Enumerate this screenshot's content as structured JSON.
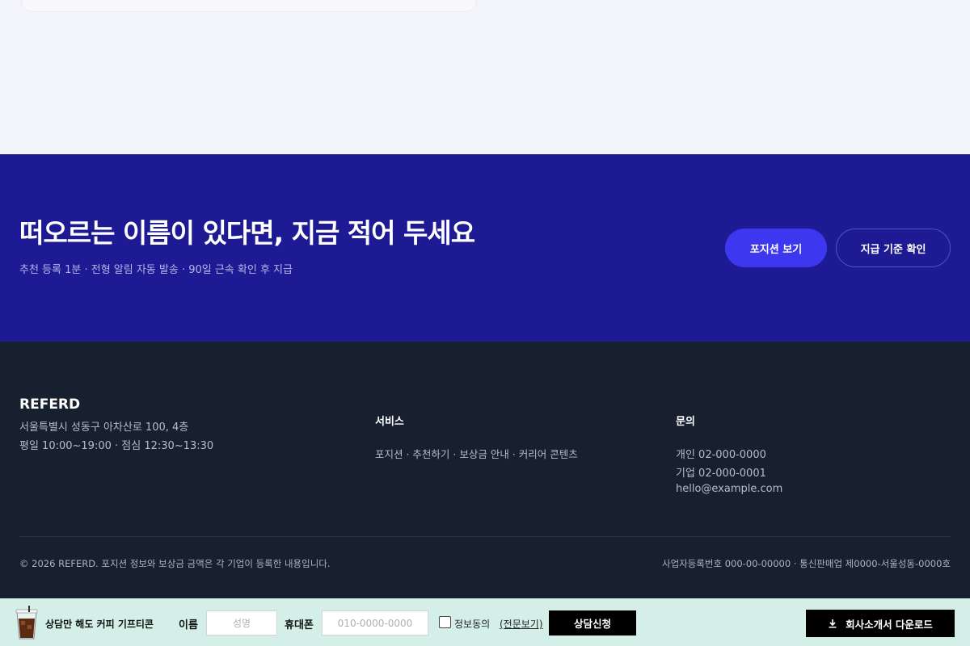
{
  "cta": {
    "title": "떠오르는 이름이 있다면, 지금 적어 두세요",
    "subtitle": "추천 등록 1분 · 전형 알림 자동 발송 · 90일 근속 확인 후 지급",
    "primary_button": "포지션 보기",
    "secondary_button": "지급 기준 확인"
  },
  "footer": {
    "brand": "REFERD",
    "address": "서울특별시 성동구 아차산로 100, 4층",
    "hours": "평일 10:00~19:00 · 점심 12:30~13:30",
    "services": {
      "heading": "서비스",
      "links": "포지션 · 추천하기 · 보상금 안내 · 커리어 콘텐츠"
    },
    "inquiry": {
      "heading": "문의",
      "personal": "개인 02-000-0000",
      "company": "기업 02-000-0001",
      "email": "hello@example.com"
    },
    "copyright": "© 2026 REFERD. 포지션 정보와 보상금 금액은 각 기업이 등록한 내용입니다.",
    "business_info": "사업자등록번호 000-00-00000 · 통신판매업 제0000-서울성동-0000호"
  },
  "consult_bar": {
    "promo": "상담만 해도 커피 기프티콘",
    "name_label": "이름",
    "name_placeholder": "성명",
    "phone_label": "휴대폰",
    "phone_placeholder": "010-0000-0000",
    "agree_label": "정보동의",
    "agree_link": "(전문보기)",
    "submit_button": "상담신청",
    "download_button": "회사소개서 다운로드"
  },
  "colors": {
    "cta_background": "#1d1a93",
    "primary_accent": "#3d37f0",
    "footer_background": "#17202f",
    "bar_background": "#d3efe8"
  },
  "icons": {
    "promo_icon": "iced-coffee-cup-icon",
    "download_icon": "download-icon"
  }
}
